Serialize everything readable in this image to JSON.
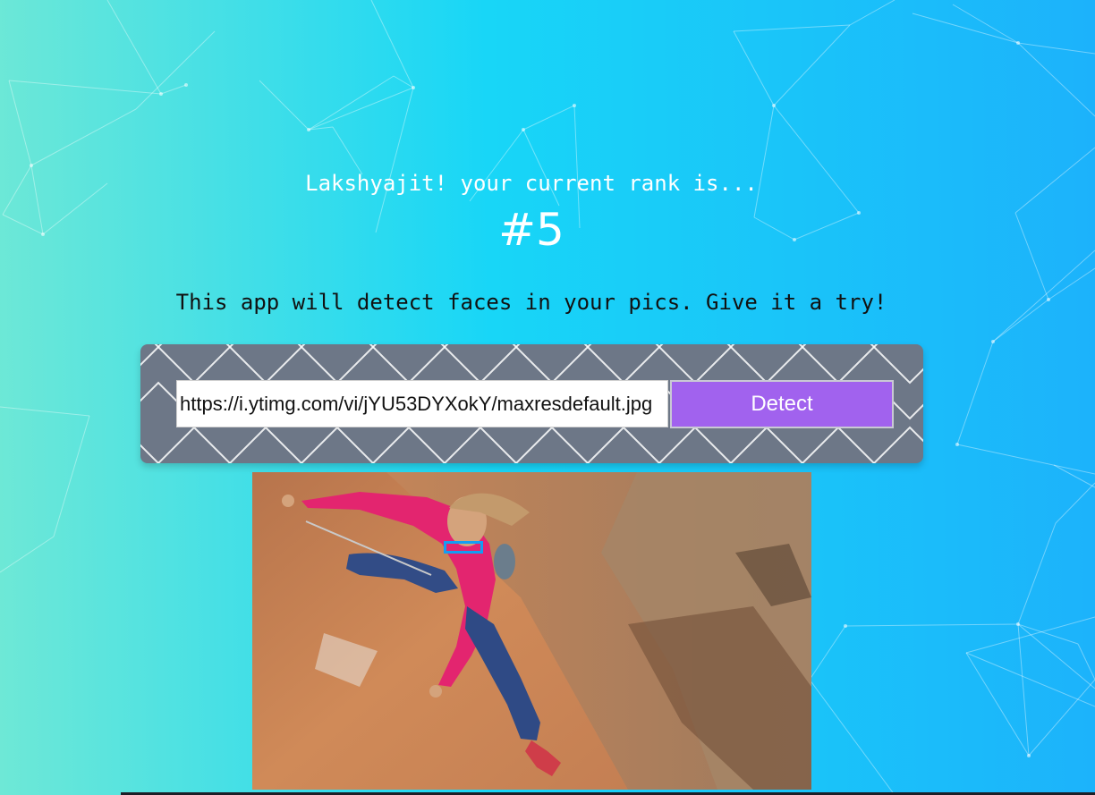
{
  "rank": {
    "greeting": "Lakshyajit! your current rank is...",
    "value": "#5"
  },
  "tagline": "This app will detect faces in your pics. Give it a try!",
  "form": {
    "url_value": "https://i.ytimg.com/vi/jYU53DYXokY/maxresdefault.jpg",
    "detect_label": "Detect"
  },
  "colors": {
    "gradient_start": "#6ee8d6",
    "gradient_end": "#1cb2fb",
    "button": "#a162ee",
    "panel": "#6d7787",
    "face_box": "#149df2"
  },
  "icons": {
    "background": "particle-network",
    "panel_pattern": "zigzag-lattice"
  }
}
